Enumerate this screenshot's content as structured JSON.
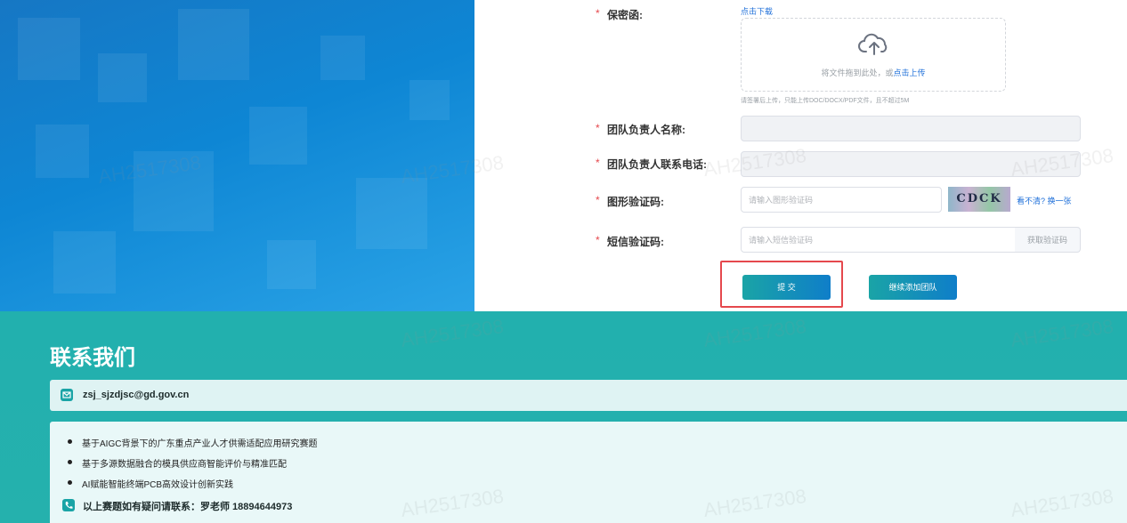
{
  "form": {
    "confidentiality": {
      "required_mark": "*",
      "label": "保密函:",
      "download_link": "点击下载",
      "upload_text_prefix": "将文件拖到此处，或",
      "upload_link": "点击上传",
      "hint": "请签署后上传，只能上传DOC/DOCX/PDF文件，且不超过5M"
    },
    "leader_name": {
      "required_mark": "*",
      "label": "团队负责人名称:"
    },
    "leader_phone": {
      "required_mark": "*",
      "label": "团队负责人联系电话:"
    },
    "captcha": {
      "required_mark": "*",
      "label": "图形验证码:",
      "placeholder": "请输入图形验证码",
      "image_text": "CDCK",
      "refresh_link": "看不清? 换一张"
    },
    "sms": {
      "required_mark": "*",
      "label": "短信验证码:",
      "placeholder": "请输入短信验证码",
      "get_code_button": "获取验证码"
    },
    "submit_button": "提 交",
    "add_team_button": "继续添加团队"
  },
  "contact": {
    "title": "联系我们",
    "email": "zsj_sjzdjsc@gd.gov.cn",
    "topics": [
      "基于AIGC背景下的广东重点产业人才供需适配应用研究赛题",
      "基于多源数据融合的模具供应商智能评价与精准匹配",
      "AI赋能智能终端PCB高效设计创新实践"
    ],
    "phone_line": "以上赛题如有疑问请联系：罗老师 18894644973"
  },
  "watermark": "AH2517308",
  "colors": {
    "accent_teal": "#22b0ae",
    "left_blue": "#1677c4",
    "required_red": "#e5484d",
    "link_blue": "#1e6fd9"
  }
}
